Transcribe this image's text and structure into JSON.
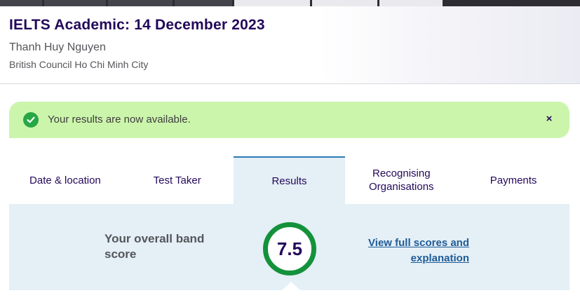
{
  "header": {
    "exam_title": "IELTS Academic: 14 December 2023",
    "candidate_name": "Thanh Huy Nguyen",
    "test_centre": "British Council Ho Chi Minh City"
  },
  "alert": {
    "message": "Your results are now available.",
    "close_label": "×",
    "icon": "check-circle-icon",
    "background_color": "#ccf5ac",
    "icon_color": "#28a745"
  },
  "tabs": [
    {
      "label": "Date & location",
      "active": false
    },
    {
      "label": "Test Taker",
      "active": false
    },
    {
      "label": "Results",
      "active": true
    },
    {
      "label": "Recognising Organisations",
      "active": false
    },
    {
      "label": "Payments",
      "active": false
    }
  ],
  "results": {
    "band_label": "Your overall band score",
    "overall_band": "7.5",
    "view_link": "View full scores and explanation",
    "ring_color": "#14923b"
  },
  "colors": {
    "brand_text": "#23085a",
    "panel_bg": "#e4eff6",
    "link": "#1f5b96"
  }
}
